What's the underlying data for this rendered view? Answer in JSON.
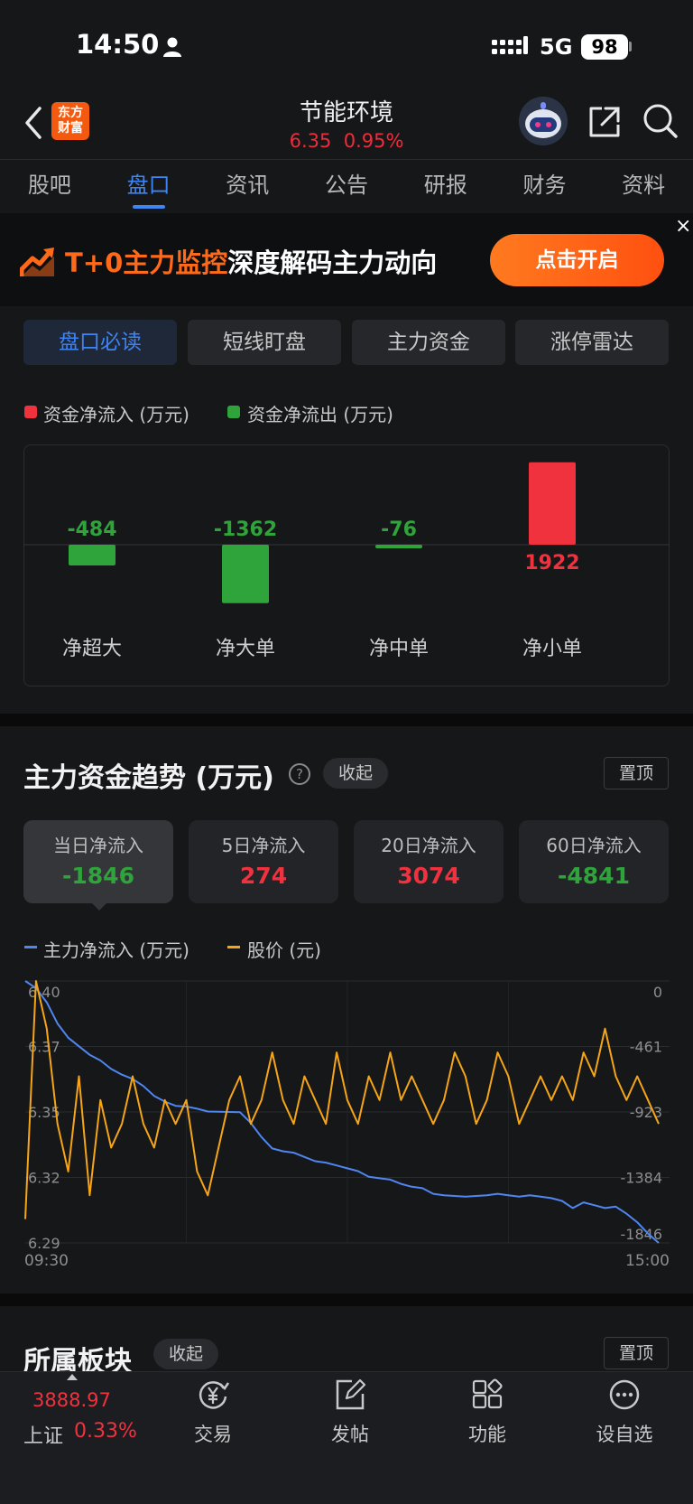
{
  "status_bar": {
    "time": "14:50",
    "network": "5G",
    "battery": "98"
  },
  "header": {
    "app_logo": [
      "东方",
      "财富"
    ],
    "stock_name": "节能环境",
    "price": "6.35",
    "change_pct": "0.95%"
  },
  "tabs": [
    "股吧",
    "盘口",
    "资讯",
    "公告",
    "研报",
    "财务",
    "资料"
  ],
  "active_tab": "盘口",
  "banner": {
    "highlight": "T+0主力监控",
    "text": "深度解码主力动向",
    "button": "点击开启",
    "close": "×"
  },
  "sub_tabs": [
    "盘口必读",
    "短线盯盘",
    "主力资金",
    "涨停雷达"
  ],
  "flow_legend": {
    "inflow": "资金净流入 (万元)",
    "outflow": "资金净流出 (万元)"
  },
  "flow_chart": {
    "type": "bar",
    "categories": [
      "净超大",
      "净大单",
      "净中单",
      "净小单"
    ],
    "values": [
      -484,
      -1362,
      -76,
      1922
    ],
    "labels": [
      "-484",
      "-1362",
      "-76",
      "1922"
    ]
  },
  "trend": {
    "title": "主力资金趋势 (万元)",
    "help": "?",
    "collapse": "收起",
    "pin": "置顶",
    "cards": [
      {
        "label": "当日净流入",
        "value": "-1846",
        "sign": "neg"
      },
      {
        "label": "5日净流入",
        "value": "274",
        "sign": "pos"
      },
      {
        "label": "20日净流入",
        "value": "3074",
        "sign": "pos"
      },
      {
        "label": "60日净流入",
        "value": "-4841",
        "sign": "neg"
      }
    ],
    "legend": {
      "main": "主力净流入 (万元)",
      "price": "股价 (元)"
    }
  },
  "chart_data": {
    "type": "line",
    "x_start": "09:30",
    "x_end": "15:00",
    "left_axis_ticks": [
      "6.40",
      "6.37",
      "6.35",
      "6.32",
      "6.29"
    ],
    "right_axis_ticks": [
      "0",
      "-461",
      "-923",
      "-1384",
      "-1846"
    ],
    "series": [
      {
        "name": "主力净流入 (万元)",
        "axis": "right",
        "color": "#4f86f0",
        "values": [
          0,
          -50,
          -150,
          -300,
          -400,
          -460,
          -520,
          -560,
          -620,
          -660,
          -690,
          -740,
          -810,
          -850,
          -880,
          -885,
          -900,
          -920,
          -922,
          -923,
          -925,
          -1000,
          -1100,
          -1180,
          -1200,
          -1210,
          -1240,
          -1270,
          -1280,
          -1300,
          -1320,
          -1340,
          -1380,
          -1390,
          -1400,
          -1430,
          -1450,
          -1460,
          -1500,
          -1510,
          -1515,
          -1520,
          -1515,
          -1510,
          -1500,
          -1510,
          -1520,
          -1510,
          -1520,
          -1530,
          -1550,
          -1600,
          -1560,
          -1580,
          -1600,
          -1590,
          -1640,
          -1700,
          -1780,
          -1846
        ]
      },
      {
        "name": "股价 (元)",
        "axis": "left",
        "color": "#f5a516",
        "values": [
          6.3,
          6.4,
          6.38,
          6.34,
          6.32,
          6.36,
          6.31,
          6.35,
          6.33,
          6.34,
          6.36,
          6.34,
          6.33,
          6.35,
          6.34,
          6.35,
          6.32,
          6.31,
          6.33,
          6.35,
          6.36,
          6.34,
          6.35,
          6.37,
          6.35,
          6.34,
          6.36,
          6.35,
          6.34,
          6.37,
          6.35,
          6.34,
          6.36,
          6.35,
          6.37,
          6.35,
          6.36,
          6.35,
          6.34,
          6.35,
          6.37,
          6.36,
          6.34,
          6.35,
          6.37,
          6.36,
          6.34,
          6.35,
          6.36,
          6.35,
          6.36,
          6.35,
          6.37,
          6.36,
          6.38,
          6.36,
          6.35,
          6.36,
          6.35,
          6.34
        ]
      }
    ]
  },
  "sector": {
    "title": "所属板块",
    "collapse": "收起",
    "pin": "置顶"
  },
  "bottom_bar": {
    "index_value": "3888.97",
    "index_name": "上证",
    "index_change": "0.33%",
    "items": [
      "交易",
      "发帖",
      "功能",
      "设自选"
    ]
  }
}
